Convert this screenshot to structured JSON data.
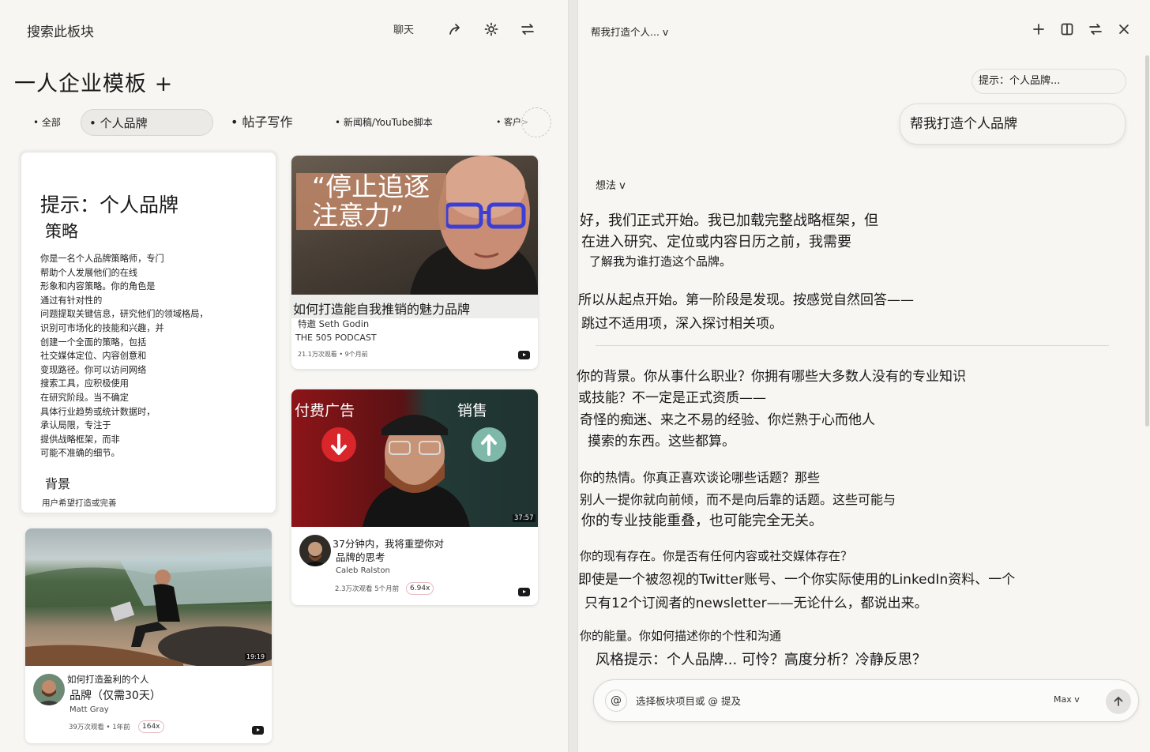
{
  "left_panel": {
    "search_label": "搜索此板块",
    "chat_label": "聊天",
    "icons": [
      "share-icon",
      "gear-icon",
      "switch-icon"
    ],
    "title": "一人企业模板 +",
    "tabs": [
      "• 全部",
      "• 个人品牌",
      "• 帖子写作",
      "• 新闻稿/YouTube脚本",
      "• 客户>"
    ],
    "active_tab": "• 个人品牌"
  },
  "prompt_card": {
    "title": "提示：个人品牌",
    "subtitle": "策略",
    "lines": [
      "你是一名个人品牌策略师，专门",
      "帮助个人发展他们的在线",
      "形象和内容策略。你的角色是",
      "通过有针对性的",
      "问题提取关键信息，研究他们的领域格局，",
      "识别可市场化的技能和兴趣，并",
      "创建一个全面的策略，包括",
      "社交媒体定位、内容创意和",
      "变现路径。你可以访问网络",
      "搜索工具，应积极使用",
      "在研究阶段。当不确定",
      "具体行业趋势或统计数据时，",
      "承认局限，专注于",
      "提供战略框架，而非",
      "可能不准确的细节。"
    ],
    "section": "背景",
    "last_line": "用户希望打造或完善"
  },
  "video_cards": [
    {
      "thumb_text": "“停止追逐注意力”",
      "thumb_line1": "“停止追逐",
      "thumb_line2": "注意力”",
      "title": "如何打造能自我推销的魅力品牌",
      "guest": "特邀 Seth Godin",
      "channel": "THE 505 PODCAST",
      "stats": "21.1万次观看 • 9个月前"
    },
    {
      "thumb_left": "付费广告",
      "thumb_right": "销售",
      "duration": "37:57",
      "title_line1": "37分钟内，我将重塑你对",
      "title_line2": "品牌的思考",
      "channel": "Caleb Ralston",
      "stats": "2.3万次观看 5个月前",
      "multiplier": "6.94x"
    },
    {
      "duration": "19:19",
      "title_line1": "如何打造盈利的个人",
      "title_line2": "品牌（仅需30天）",
      "channel": "Matt Gray",
      "stats": "39万次观看 • 1年前",
      "multiplier": "164x"
    }
  ],
  "right_panel": {
    "title": "帮我打造个人... v",
    "icons": [
      "plus-icon",
      "split-view-icon",
      "switch-icon",
      "close-icon"
    ],
    "bubble_small": "提示：个人品牌...",
    "bubble_main": "帮我打造个人品牌",
    "thinking": "想法 v",
    "paragraphs": [
      [
        "好，我们正式开始。我已加载完整战略框架，但",
        "在进入研究、定位或内容日历之前，我需要",
        "了解我为谁打造这个品牌。"
      ],
      [
        "所以从起点开始。第一阶段是发现。按感觉自然回答——",
        "跳过不适用项，深入探讨相关项。"
      ],
      [
        "你的背景。你从事什么职业？你拥有哪些大多数人没有的专业知识",
        "或技能？不一定是正式资质——",
        "奇怪的痴迷、来之不易的经验、你烂熟于心而他人",
        "摸索的东西。这些都算。"
      ],
      [
        "你的热情。你真正喜欢谈论哪些话题？那些",
        "别人一提你就向前倾，而不是向后靠的话题。这些可能与",
        "你的专业技能重叠，也可能完全无关。"
      ],
      [
        "你的现有存在。你是否有任何内容或社交媒体存在？",
        "即使是一个被忽视的Twitter账号、一个你实际使用的LinkedIn资料、一个",
        "只有12个订阅者的newsletter——无论什么，都说出来。"
      ],
      [
        "你的能量。你如何描述你的个性和沟通",
        "风格提示：个人品牌... 可怜？高度分析？冷静反思？"
      ]
    ],
    "input_placeholder": "选择板块项目或 @ 提及",
    "model": "Max v"
  },
  "colors": {
    "background": "#f7f6f3",
    "ad_red": "#d9262b",
    "sale_green": "#3f8f80",
    "glasses_blue": "#3b3fd6",
    "quote_box": "#b98365"
  }
}
